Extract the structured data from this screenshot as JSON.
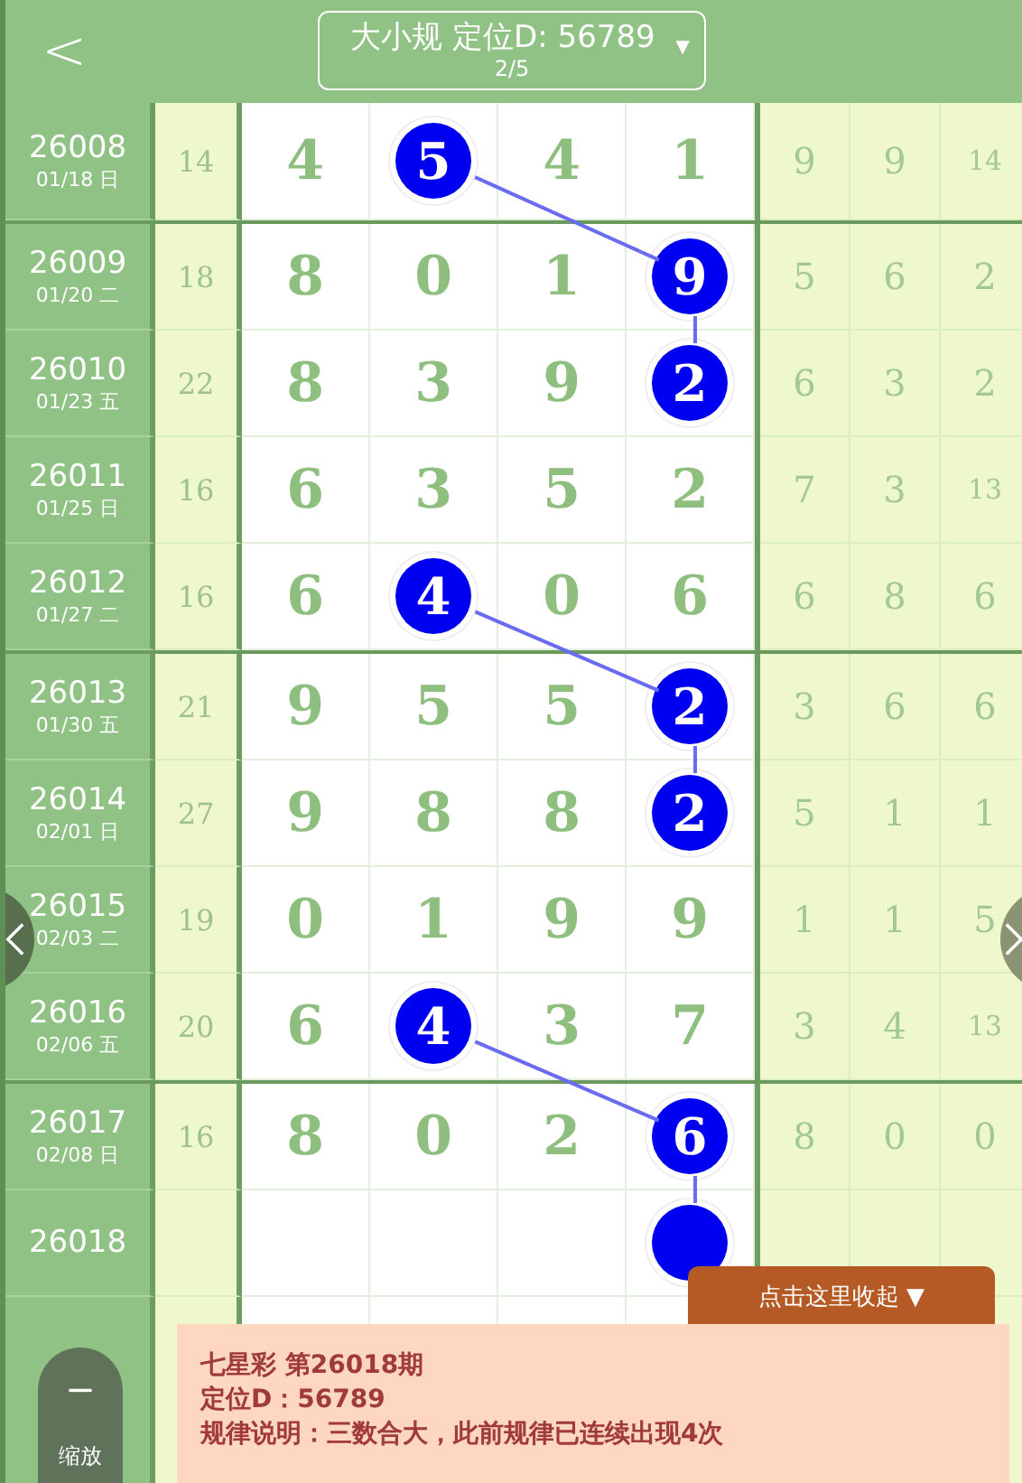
{
  "header": {
    "back": "<",
    "title": "大小规 定位D: 56789",
    "page": "2/5",
    "caret": "▼"
  },
  "rows": [
    {
      "period": "26008",
      "date": "01/18 日",
      "sum": "14",
      "digits": [
        {
          "value": "4",
          "highlighted": false
        },
        {
          "value": "5",
          "highlighted": true
        },
        {
          "value": "4",
          "highlighted": false
        },
        {
          "value": "1",
          "highlighted": false
        }
      ],
      "extra": [
        "9",
        "9",
        "14"
      ],
      "divider_above": false
    },
    {
      "period": "26009",
      "date": "01/20 二",
      "sum": "18",
      "digits": [
        {
          "value": "8",
          "highlighted": false
        },
        {
          "value": "0",
          "highlighted": false
        },
        {
          "value": "1",
          "highlighted": false
        },
        {
          "value": "9",
          "highlighted": true
        }
      ],
      "extra": [
        "5",
        "6",
        "2"
      ],
      "divider_above": true
    },
    {
      "period": "26010",
      "date": "01/23 五",
      "sum": "22",
      "digits": [
        {
          "value": "8",
          "highlighted": false
        },
        {
          "value": "3",
          "highlighted": false
        },
        {
          "value": "9",
          "highlighted": false
        },
        {
          "value": "2",
          "highlighted": true
        }
      ],
      "extra": [
        "6",
        "3",
        "2"
      ],
      "divider_above": false
    },
    {
      "period": "26011",
      "date": "01/25 日",
      "sum": "16",
      "digits": [
        {
          "value": "6",
          "highlighted": false
        },
        {
          "value": "3",
          "highlighted": false
        },
        {
          "value": "5",
          "highlighted": false
        },
        {
          "value": "2",
          "highlighted": false
        }
      ],
      "extra": [
        "7",
        "3",
        "13"
      ],
      "divider_above": false
    },
    {
      "period": "26012",
      "date": "01/27 二",
      "sum": "16",
      "digits": [
        {
          "value": "6",
          "highlighted": false
        },
        {
          "value": "4",
          "highlighted": true
        },
        {
          "value": "0",
          "highlighted": false
        },
        {
          "value": "6",
          "highlighted": false
        }
      ],
      "extra": [
        "6",
        "8",
        "6"
      ],
      "divider_above": false
    },
    {
      "period": "26013",
      "date": "01/30 五",
      "sum": "21",
      "digits": [
        {
          "value": "9",
          "highlighted": false
        },
        {
          "value": "5",
          "highlighted": false
        },
        {
          "value": "5",
          "highlighted": false
        },
        {
          "value": "2",
          "highlighted": true
        }
      ],
      "extra": [
        "3",
        "6",
        "6"
      ],
      "divider_above": true
    },
    {
      "period": "26014",
      "date": "02/01 日",
      "sum": "27",
      "digits": [
        {
          "value": "9",
          "highlighted": false
        },
        {
          "value": "8",
          "highlighted": false
        },
        {
          "value": "8",
          "highlighted": false
        },
        {
          "value": "2",
          "highlighted": true
        }
      ],
      "extra": [
        "5",
        "1",
        "1"
      ],
      "divider_above": false
    },
    {
      "period": "26015",
      "date": "02/03 二",
      "sum": "19",
      "digits": [
        {
          "value": "0",
          "highlighted": false
        },
        {
          "value": "1",
          "highlighted": false
        },
        {
          "value": "9",
          "highlighted": false
        },
        {
          "value": "9",
          "highlighted": false
        }
      ],
      "extra": [
        "1",
        "1",
        "5"
      ],
      "divider_above": false
    },
    {
      "period": "26016",
      "date": "02/06 五",
      "sum": "20",
      "digits": [
        {
          "value": "6",
          "highlighted": false
        },
        {
          "value": "4",
          "highlighted": true
        },
        {
          "value": "3",
          "highlighted": false
        },
        {
          "value": "7",
          "highlighted": false
        }
      ],
      "extra": [
        "3",
        "4",
        "13"
      ],
      "divider_above": false
    },
    {
      "period": "26017",
      "date": "02/08 日",
      "sum": "16",
      "digits": [
        {
          "value": "8",
          "highlighted": false
        },
        {
          "value": "0",
          "highlighted": false
        },
        {
          "value": "2",
          "highlighted": false
        },
        {
          "value": "6",
          "highlighted": true
        }
      ],
      "extra": [
        "8",
        "0",
        "0"
      ],
      "divider_above": true
    },
    {
      "period": "26018",
      "digits": [
        {
          "highlighted": false
        },
        {
          "highlighted": false
        },
        {
          "highlighted": false
        },
        {
          "highlighted": true
        }
      ],
      "divider_above": false
    }
  ],
  "zoom": {
    "symbol": "−",
    "label": "缩放"
  },
  "collapse_tab": {
    "label": "点击这里收起 ▼"
  },
  "info": {
    "lines": [
      "七星彩 第26018期",
      "定位D：56789",
      "规律说明：三数合大，此前规律已连续出现4次"
    ]
  }
}
